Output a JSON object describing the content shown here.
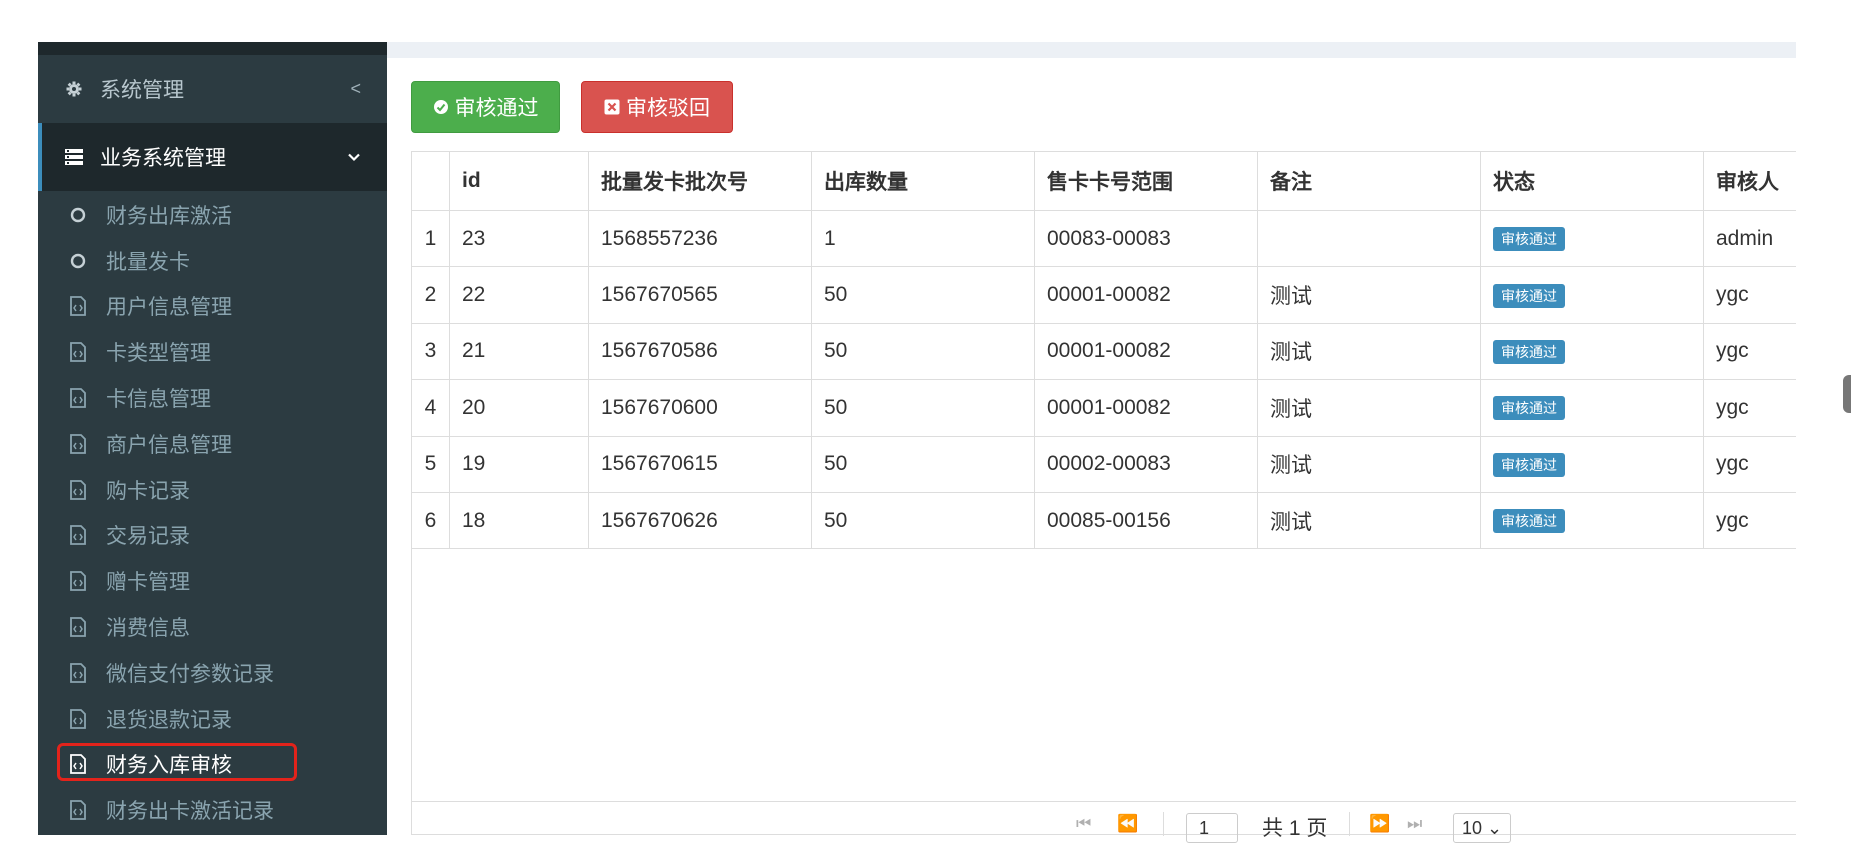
{
  "sidebar": {
    "groups": [
      {
        "label": "系统管理",
        "icon": "gear-icon",
        "arrow": "<"
      },
      {
        "label": "业务系统管理",
        "icon": "list-icon",
        "arrow": "⌄"
      }
    ],
    "items": [
      {
        "label": "财务出库激活",
        "icon": "circle-icon"
      },
      {
        "label": "批量发卡",
        "icon": "circle-icon"
      },
      {
        "label": "用户信息管理",
        "icon": "file-code-icon"
      },
      {
        "label": "卡类型管理",
        "icon": "file-code-icon"
      },
      {
        "label": "卡信息管理",
        "icon": "file-code-icon"
      },
      {
        "label": "商户信息管理",
        "icon": "file-code-icon"
      },
      {
        "label": "购卡记录",
        "icon": "file-code-icon"
      },
      {
        "label": "交易记录",
        "icon": "file-code-icon"
      },
      {
        "label": "赠卡管理",
        "icon": "file-code-icon"
      },
      {
        "label": "消费信息",
        "icon": "file-code-icon"
      },
      {
        "label": "微信支付参数记录",
        "icon": "file-code-icon"
      },
      {
        "label": "退货退款记录",
        "icon": "file-code-icon"
      },
      {
        "label": "财务入库审核",
        "icon": "file-code-icon",
        "selected": true
      },
      {
        "label": "财务出卡激活记录",
        "icon": "file-code-icon"
      }
    ]
  },
  "toolbar": {
    "approve_label": "审核通过",
    "reject_label": "审核驳回",
    "approve_color": "#4cae4c",
    "reject_color": "#d9534f"
  },
  "table": {
    "columns": [
      "id",
      "批量发卡批次号",
      "出库数量",
      "售卡卡号范围",
      "备注",
      "状态",
      "审核人"
    ],
    "rows": [
      {
        "n": "1",
        "id": "23",
        "batch": "1568557236",
        "qty": "1",
        "range": "00083-00083",
        "note": "",
        "status": "审核通过",
        "reviewer": "admin"
      },
      {
        "n": "2",
        "id": "22",
        "batch": "1567670565",
        "qty": "50",
        "range": "00001-00082",
        "note": "测试",
        "status": "审核通过",
        "reviewer": "ygc"
      },
      {
        "n": "3",
        "id": "21",
        "batch": "1567670586",
        "qty": "50",
        "range": "00001-00082",
        "note": "测试",
        "status": "审核通过",
        "reviewer": "ygc"
      },
      {
        "n": "4",
        "id": "20",
        "batch": "1567670600",
        "qty": "50",
        "range": "00001-00082",
        "note": "测试",
        "status": "审核通过",
        "reviewer": "ygc"
      },
      {
        "n": "5",
        "id": "19",
        "batch": "1567670615",
        "qty": "50",
        "range": "00002-00083",
        "note": "测试",
        "status": "审核通过",
        "reviewer": "ygc"
      },
      {
        "n": "6",
        "id": "18",
        "batch": "1567670626",
        "qty": "50",
        "range": "00085-00156",
        "note": "测试",
        "status": "审核通过",
        "reviewer": "ygc"
      }
    ]
  },
  "pager": {
    "page": "1",
    "total_text": "共 1 页",
    "page_size": "10"
  },
  "colors": {
    "badge": "#3c8dbc",
    "sidebar_bg": "#2c3b41",
    "highlight": "#e3231b"
  }
}
